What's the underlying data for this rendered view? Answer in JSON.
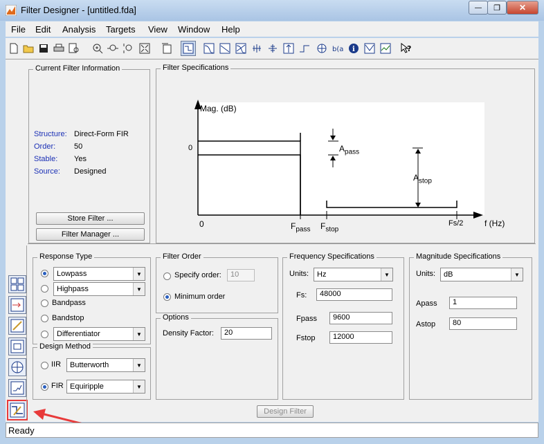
{
  "window": {
    "title": "Filter Designer - [untitled.fda]",
    "minimize": "—",
    "restore": "❐",
    "close": "✕"
  },
  "menu": [
    "File",
    "Edit",
    "Analysis",
    "Targets",
    "View",
    "Window",
    "Help"
  ],
  "toolbar_icons": [
    "new-icon",
    "open-icon",
    "save-icon",
    "print-icon",
    "print-preview-icon",
    "zoom-in-icon",
    "zoom-x-icon",
    "zoom-y-icon",
    "full-view-icon",
    "new-figure-icon",
    "filter-specs-icon",
    "magnitude-response-icon",
    "phase-response-icon",
    "mag-phase-icon",
    "group-delay-icon",
    "phase-delay-icon",
    "impulse-response-icon",
    "step-response-icon",
    "pole-zero-icon",
    "coefficients-icon",
    "info-icon",
    "cost-icon",
    "legend-icon",
    "whats-this-icon"
  ],
  "current_filter": {
    "title": "Current Filter Information",
    "structure_label": "Structure:",
    "structure": "Direct-Form FIR",
    "order_label": "Order:",
    "order": "50",
    "stable_label": "Stable:",
    "stable": "Yes",
    "source_label": "Source:",
    "source": "Designed",
    "store_button": "Store Filter ...",
    "manager_button": "Filter Manager ..."
  },
  "filter_specs": {
    "title": "Filter Specifications",
    "ylabel": "Mag. (dB)",
    "xlabel": "f (Hz)",
    "zero_y": "0",
    "zero_x": "0",
    "fpass": "F",
    "fpass_sub": "pass",
    "fstop": "F",
    "fstop_sub": "stop",
    "fs2": "Fs/2",
    "apass": "A",
    "apass_sub": "pass",
    "astop": "A",
    "astop_sub": "stop"
  },
  "response_type": {
    "title": "Response Type",
    "lowpass": "Lowpass",
    "highpass": "Highpass",
    "bandpass": "Bandpass",
    "bandstop": "Bandstop",
    "differentiator": "Differentiator"
  },
  "design_method": {
    "title": "Design Method",
    "iir_label": "IIR",
    "iir_value": "Butterworth",
    "fir_label": "FIR",
    "fir_value": "Equiripple"
  },
  "filter_order": {
    "title": "Filter Order",
    "specify_label": "Specify order:",
    "specify_value": "10",
    "minimum_label": "Minimum order"
  },
  "options": {
    "title": "Options",
    "density_label": "Density Factor:",
    "density_value": "20"
  },
  "freq_specs": {
    "title": "Frequency Specifications",
    "units_label": "Units:",
    "units": "Hz",
    "fs_label": "Fs:",
    "fs": "48000",
    "fpass_label": "Fpass",
    "fpass": "9600",
    "fstop_label": "Fstop",
    "fstop": "12000"
  },
  "mag_specs": {
    "title": "Magnitude Specifications",
    "units_label": "Units:",
    "units": "dB",
    "apass_label": "Apass",
    "apass": "1",
    "astop_label": "Astop",
    "astop": "80"
  },
  "design_button": "Design Filter",
  "status": "Ready",
  "colors": {
    "title_bar": "#b9d1ea",
    "panel": "#f0f0f0",
    "highlight": "#e83a3a",
    "label_blue": "#1a2fb5"
  }
}
